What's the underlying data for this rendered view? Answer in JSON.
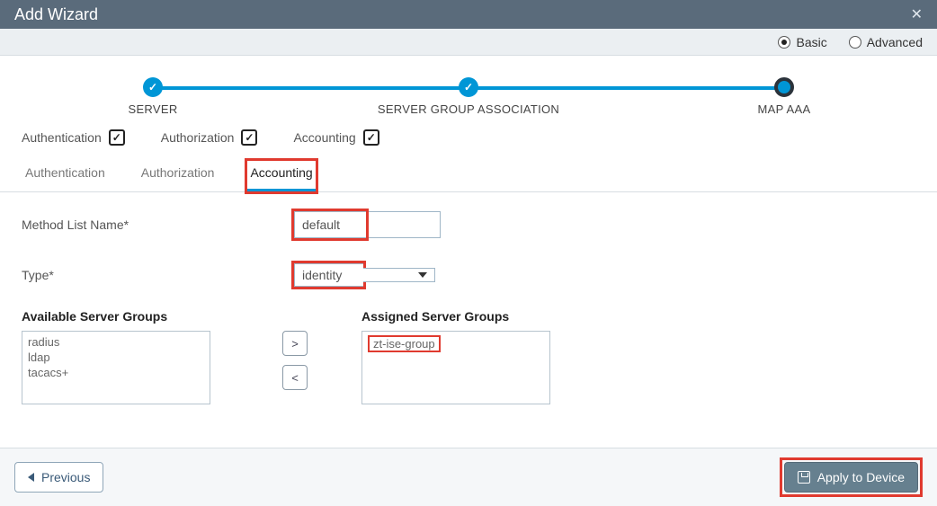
{
  "header": {
    "title": "Add Wizard"
  },
  "mode": {
    "basic": "Basic",
    "advanced": "Advanced",
    "selected": "basic"
  },
  "stepper": {
    "steps": [
      {
        "label": "SERVER",
        "state": "done"
      },
      {
        "label": "SERVER GROUP ASSOCIATION",
        "state": "done"
      },
      {
        "label": "MAP AAA",
        "state": "current"
      }
    ]
  },
  "aaa_checks": {
    "authentication": {
      "label": "Authentication",
      "checked": true
    },
    "authorization": {
      "label": "Authorization",
      "checked": true
    },
    "accounting": {
      "label": "Accounting",
      "checked": true
    }
  },
  "tabs": {
    "items": [
      {
        "id": "authn",
        "label": "Authentication"
      },
      {
        "id": "authz",
        "label": "Authorization"
      },
      {
        "id": "acct",
        "label": "Accounting"
      }
    ],
    "active": "acct"
  },
  "form": {
    "method_list_name": {
      "label": "Method List Name*",
      "value": "default"
    },
    "type": {
      "label": "Type*",
      "value": "identity"
    }
  },
  "groups": {
    "available_title": "Available Server Groups",
    "assigned_title": "Assigned Server Groups",
    "available": [
      "radius",
      "ldap",
      "tacacs+"
    ],
    "assigned": [
      "zt-ise-group"
    ]
  },
  "footer": {
    "previous": "Previous",
    "apply": "Apply to Device"
  }
}
